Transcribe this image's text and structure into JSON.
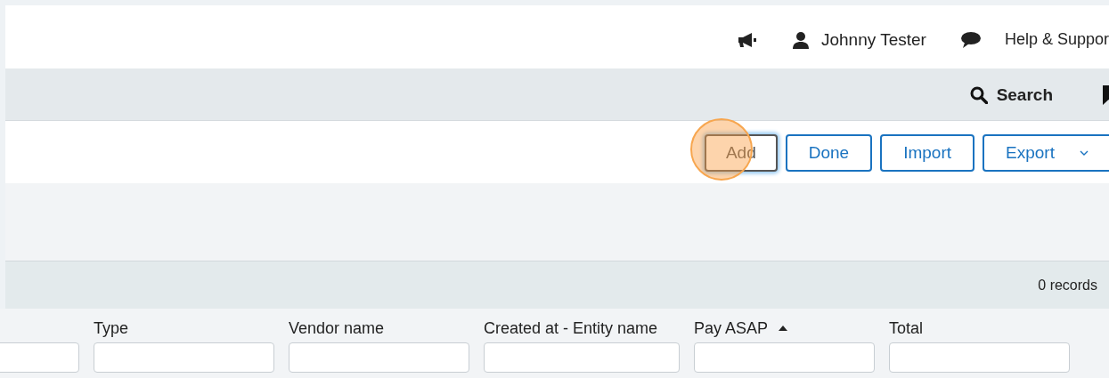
{
  "top_bar": {
    "user": "Johnny Tester",
    "help": "Help & Suppor"
  },
  "nav_bar": {
    "search": "Search"
  },
  "toolbar": {
    "buttons": [
      {
        "label": "Add",
        "focused": true,
        "dropdown": false
      },
      {
        "label": "Done",
        "focused": false,
        "dropdown": false
      },
      {
        "label": "Import",
        "focused": false,
        "dropdown": false
      },
      {
        "label": "Export",
        "focused": false,
        "dropdown": true
      }
    ]
  },
  "records": "0 records",
  "table": {
    "columns": [
      {
        "kind": "filter"
      },
      {
        "label": "Type",
        "sorted": false
      },
      {
        "label": "Vendor name",
        "sorted": false
      },
      {
        "label": "Created at - Entity name",
        "sorted": false
      },
      {
        "label": "Pay ASAP",
        "sorted": true
      },
      {
        "label": "Total",
        "sorted": false
      }
    ]
  }
}
